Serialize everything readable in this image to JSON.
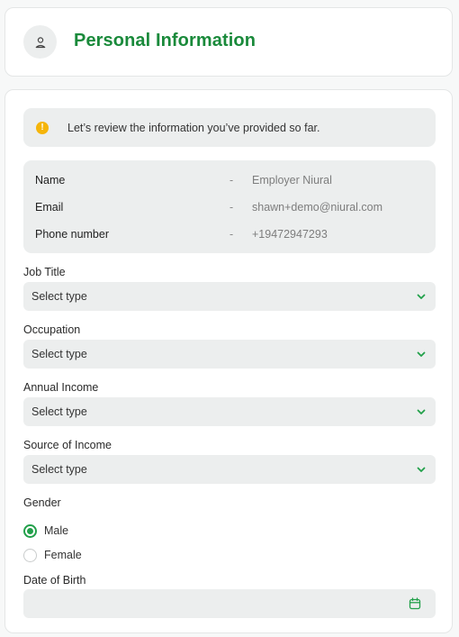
{
  "header": {
    "title": "Personal Information",
    "icon": "user-icon"
  },
  "notice": {
    "icon": "info-icon",
    "icon_glyph": "!",
    "text": "Let’s review the information you’ve provided so far."
  },
  "summary": {
    "separator": "-",
    "rows": [
      {
        "label": "Name",
        "value": "Employer Niural"
      },
      {
        "label": "Email",
        "value": "shawn+demo@niural.com"
      },
      {
        "label": "Phone number",
        "value": "+19472947293"
      }
    ]
  },
  "form": {
    "job_title": {
      "label": "Job Title",
      "value": "Select type"
    },
    "occupation": {
      "label": "Occupation",
      "value": "Select type"
    },
    "annual_income": {
      "label": "Annual Income",
      "value": "Select type"
    },
    "source_of_income": {
      "label": "Source of Income",
      "value": "Select type"
    },
    "gender": {
      "label": "Gender",
      "options": [
        {
          "label": "Male",
          "checked": true
        },
        {
          "label": "Female",
          "checked": false
        }
      ]
    },
    "date_of_birth": {
      "label": "Date of Birth",
      "value": "",
      "icon": "calendar-icon"
    }
  },
  "colors": {
    "accent": "#1a8a3b",
    "radio_checked": "#22a04a",
    "info": "#f5b50a",
    "field_bg": "#eceeee"
  }
}
